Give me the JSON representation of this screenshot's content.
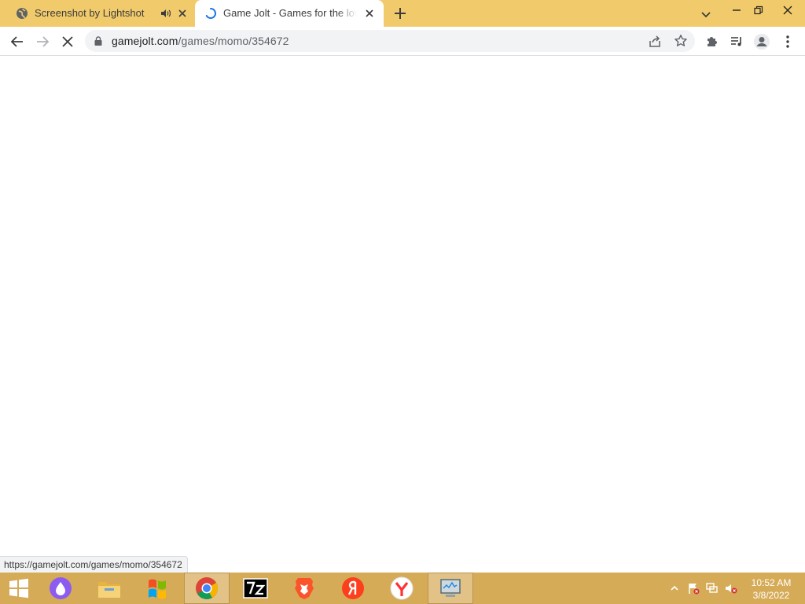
{
  "browser": {
    "tabs": [
      {
        "title": "Screenshot by Lightshot",
        "favicon": "globe-icon",
        "audio": true,
        "active": false
      },
      {
        "title": "Game Jolt - Games for the love of",
        "favicon": "loading-spinner-icon",
        "audio": false,
        "active": true
      }
    ],
    "address": {
      "host": "gamejolt.com",
      "path": "/games/momo/354672"
    },
    "status_url": "https://gamejolt.com/games/momo/354672"
  },
  "taskbar": {
    "apps": [
      "windows-start-icon",
      "alice-assistant-icon",
      "file-explorer-icon",
      "windows-xp-icon",
      "chrome-icon",
      "7zip-icon",
      "brave-icon",
      "yandex-ya-icon",
      "yandex-browser-icon",
      "system-monitor-icon"
    ],
    "clock": {
      "time": "10:52 AM",
      "date": "3/8/2022"
    }
  },
  "colors": {
    "titlebar": "#f1cb6b",
    "taskbar": "#d6ab57",
    "page_background": "#ffffff"
  }
}
